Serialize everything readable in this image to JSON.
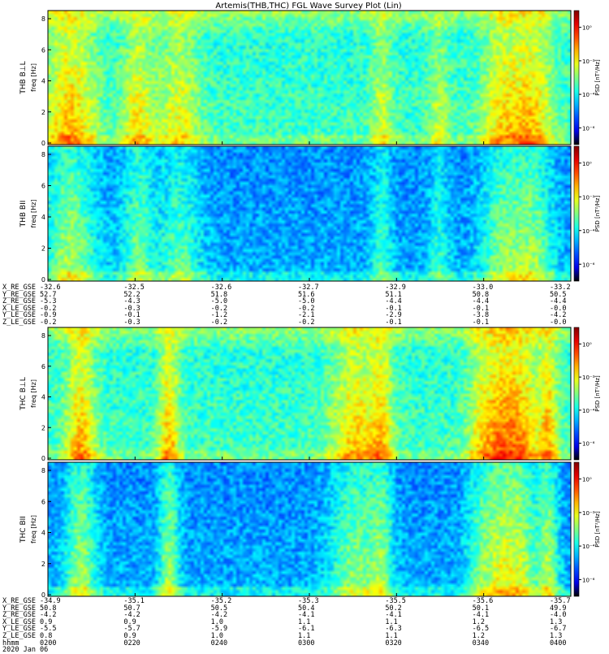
{
  "title": "Artemis(THB,THC) FGL Wave Survey Plot (Lin)",
  "chart_data": {
    "type": "heatmap",
    "title": "Artemis(THB,THC) FGL Wave Survey Plot (Lin)",
    "panels": [
      {
        "id": "thb-bll",
        "label": "THB B⊥L",
        "ylabel": "freq [Hz]",
        "ylim": [
          0,
          8
        ],
        "yticks": [
          "0",
          "2",
          "4",
          "6",
          "8"
        ],
        "colorbar": {
          "label": "PSD [nT²/Hz]",
          "ticks": [
            "10⁰",
            "10⁻²",
            "10⁻⁴",
            "10⁻⁶"
          ],
          "range_log10": [
            -7,
            1
          ]
        }
      },
      {
        "id": "thb-bii",
        "label": "THB BII",
        "ylabel": "freq [Hz]",
        "ylim": [
          0,
          8
        ],
        "yticks": [
          "0",
          "2",
          "4",
          "6",
          "8"
        ],
        "colorbar": {
          "label": "PSD [nT²/Hz]",
          "ticks": [
            "10⁰",
            "10⁻²",
            "10⁻⁴",
            "10⁻⁶"
          ],
          "range_log10": [
            -7,
            1
          ]
        }
      },
      {
        "id": "thc-bll",
        "label": "THC B⊥L",
        "ylabel": "freq [Hz]",
        "ylim": [
          0,
          8
        ],
        "yticks": [
          "0",
          "2",
          "4",
          "6",
          "8"
        ],
        "colorbar": {
          "label": "PSD [nT²/Hz]",
          "ticks": [
            "10⁰",
            "10⁻²",
            "10⁻⁴",
            "10⁻⁶"
          ],
          "range_log10": [
            -7,
            1
          ]
        }
      },
      {
        "id": "thc-bii",
        "label": "THC BII",
        "ylabel": "freq [Hz]",
        "ylim": [
          0,
          8
        ],
        "yticks": [
          "0",
          "2",
          "4",
          "6",
          "8"
        ],
        "colorbar": {
          "label": "PSD [nT²/Hz]",
          "ticks": [
            "10⁰",
            "10⁻²",
            "10⁻⁴",
            "10⁻⁶"
          ],
          "range_log10": [
            -7,
            1
          ]
        }
      }
    ],
    "bursts_thb": [
      {
        "t": 0.04,
        "w": 0.05,
        "f": 1.0
      },
      {
        "t": 0.17,
        "w": 0.03,
        "f": 0.8
      },
      {
        "t": 0.25,
        "w": 0.04,
        "f": 0.7
      },
      {
        "t": 0.64,
        "w": 0.02,
        "f": 0.6
      },
      {
        "t": 0.75,
        "w": 0.02,
        "f": 0.5
      },
      {
        "t": 0.87,
        "w": 0.04,
        "f": 0.8
      },
      {
        "t": 0.93,
        "w": 0.04,
        "f": 0.9
      }
    ],
    "bursts_thc": [
      {
        "t": 0.06,
        "w": 0.03,
        "f": 1.0
      },
      {
        "t": 0.23,
        "w": 0.02,
        "f": 1.0
      },
      {
        "t": 0.59,
        "w": 0.05,
        "f": 0.9
      },
      {
        "t": 0.64,
        "w": 0.02,
        "f": 0.7
      },
      {
        "t": 0.83,
        "w": 0.03,
        "f": 0.7
      },
      {
        "t": 0.87,
        "w": 0.03,
        "f": 1.0
      },
      {
        "t": 0.91,
        "w": 0.03,
        "f": 1.0
      },
      {
        "t": 0.96,
        "w": 0.02,
        "f": 1.0
      }
    ]
  },
  "ephem_thb": {
    "rows": [
      {
        "label": "X_RE_GSE",
        "values": [
          "-32.6",
          "-32.5",
          "-32.6",
          "-32.7",
          "-32.9",
          "-33.0",
          "-33.2"
        ]
      },
      {
        "label": "Y_RE_GSE",
        "values": [
          "52.7",
          "52.2",
          "51.8",
          "51.6",
          "51.1",
          "50.8",
          "50.5"
        ]
      },
      {
        "label": "Z_RE_GSE",
        "values": [
          "-5.3",
          "-4.3",
          "-5.0",
          "-5.0",
          "-4.4",
          "-4.4",
          "-4.4"
        ]
      },
      {
        "label": "X_LE_GSE",
        "values": [
          "-0.2",
          "-0.3",
          "-0.2",
          "-0.2",
          "-0.1",
          "-0.1",
          "-0.0"
        ]
      },
      {
        "label": "Y_LE_GSE",
        "values": [
          "-0.9",
          "-0.1",
          "-1.2",
          "-2.1",
          "-2.9",
          "-3.8",
          "-4.2"
        ]
      },
      {
        "label": "Z_LE_GSE",
        "values": [
          "-0.2",
          "-0.3",
          "-0.2",
          "-0.2",
          "-0.1",
          "-0.1",
          "-0.0"
        ]
      }
    ]
  },
  "ephem_thc": {
    "rows": [
      {
        "label": "X_RE_GSE",
        "values": [
          "-34.9",
          "-35.1",
          "-35.2",
          "-35.3",
          "-35.5",
          "-35.6",
          "-35.7"
        ]
      },
      {
        "label": "Y_RE_GSE",
        "values": [
          "50.8",
          "50.7",
          "50.5",
          "50.4",
          "50.2",
          "50.1",
          "49.9"
        ]
      },
      {
        "label": "Z_RE_GSE",
        "values": [
          "-4.2",
          "-4.2",
          "-4.2",
          "-4.1",
          "-4.1",
          "-4.1",
          "-4.0"
        ]
      },
      {
        "label": "X_LE_GSE",
        "values": [
          "0.9",
          "0.9",
          "1.0",
          "1.1",
          "1.1",
          "1.2",
          "1.3"
        ]
      },
      {
        "label": "Y_LE_GSE",
        "values": [
          "-5.5",
          "-5.7",
          "-5.9",
          "-6.1",
          "-6.3",
          "-6.5",
          "-6.7"
        ]
      },
      {
        "label": "Z_LE_GSE",
        "values": [
          "0.8",
          "0.9",
          "1.0",
          "1.1",
          "1.1",
          "1.2",
          "1.3"
        ]
      }
    ],
    "time_label": "hhmm",
    "times": [
      "0200",
      "0220",
      "0240",
      "0300",
      "0320",
      "0340",
      "0400"
    ],
    "date": "2020 Jan 06"
  }
}
